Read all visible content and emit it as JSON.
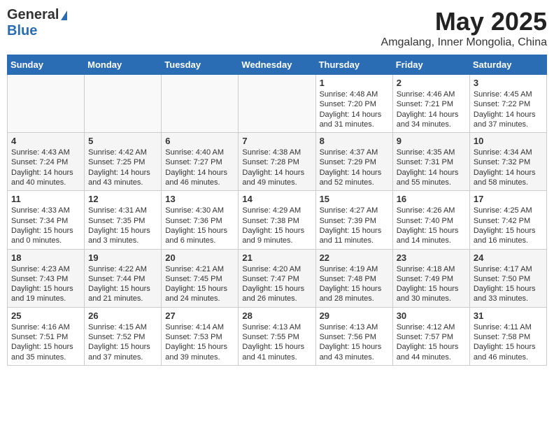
{
  "logo": {
    "general": "General",
    "blue": "Blue"
  },
  "title": "May 2025",
  "location": "Amgalang, Inner Mongolia, China",
  "days_of_week": [
    "Sunday",
    "Monday",
    "Tuesday",
    "Wednesday",
    "Thursday",
    "Friday",
    "Saturday"
  ],
  "weeks": [
    [
      {
        "day": "",
        "content": ""
      },
      {
        "day": "",
        "content": ""
      },
      {
        "day": "",
        "content": ""
      },
      {
        "day": "",
        "content": ""
      },
      {
        "day": "1",
        "content": "Sunrise: 4:48 AM\nSunset: 7:20 PM\nDaylight: 14 hours\nand 31 minutes."
      },
      {
        "day": "2",
        "content": "Sunrise: 4:46 AM\nSunset: 7:21 PM\nDaylight: 14 hours\nand 34 minutes."
      },
      {
        "day": "3",
        "content": "Sunrise: 4:45 AM\nSunset: 7:22 PM\nDaylight: 14 hours\nand 37 minutes."
      }
    ],
    [
      {
        "day": "4",
        "content": "Sunrise: 4:43 AM\nSunset: 7:24 PM\nDaylight: 14 hours\nand 40 minutes."
      },
      {
        "day": "5",
        "content": "Sunrise: 4:42 AM\nSunset: 7:25 PM\nDaylight: 14 hours\nand 43 minutes."
      },
      {
        "day": "6",
        "content": "Sunrise: 4:40 AM\nSunset: 7:27 PM\nDaylight: 14 hours\nand 46 minutes."
      },
      {
        "day": "7",
        "content": "Sunrise: 4:38 AM\nSunset: 7:28 PM\nDaylight: 14 hours\nand 49 minutes."
      },
      {
        "day": "8",
        "content": "Sunrise: 4:37 AM\nSunset: 7:29 PM\nDaylight: 14 hours\nand 52 minutes."
      },
      {
        "day": "9",
        "content": "Sunrise: 4:35 AM\nSunset: 7:31 PM\nDaylight: 14 hours\nand 55 minutes."
      },
      {
        "day": "10",
        "content": "Sunrise: 4:34 AM\nSunset: 7:32 PM\nDaylight: 14 hours\nand 58 minutes."
      }
    ],
    [
      {
        "day": "11",
        "content": "Sunrise: 4:33 AM\nSunset: 7:34 PM\nDaylight: 15 hours\nand 0 minutes."
      },
      {
        "day": "12",
        "content": "Sunrise: 4:31 AM\nSunset: 7:35 PM\nDaylight: 15 hours\nand 3 minutes."
      },
      {
        "day": "13",
        "content": "Sunrise: 4:30 AM\nSunset: 7:36 PM\nDaylight: 15 hours\nand 6 minutes."
      },
      {
        "day": "14",
        "content": "Sunrise: 4:29 AM\nSunset: 7:38 PM\nDaylight: 15 hours\nand 9 minutes."
      },
      {
        "day": "15",
        "content": "Sunrise: 4:27 AM\nSunset: 7:39 PM\nDaylight: 15 hours\nand 11 minutes."
      },
      {
        "day": "16",
        "content": "Sunrise: 4:26 AM\nSunset: 7:40 PM\nDaylight: 15 hours\nand 14 minutes."
      },
      {
        "day": "17",
        "content": "Sunrise: 4:25 AM\nSunset: 7:42 PM\nDaylight: 15 hours\nand 16 minutes."
      }
    ],
    [
      {
        "day": "18",
        "content": "Sunrise: 4:23 AM\nSunset: 7:43 PM\nDaylight: 15 hours\nand 19 minutes."
      },
      {
        "day": "19",
        "content": "Sunrise: 4:22 AM\nSunset: 7:44 PM\nDaylight: 15 hours\nand 21 minutes."
      },
      {
        "day": "20",
        "content": "Sunrise: 4:21 AM\nSunset: 7:45 PM\nDaylight: 15 hours\nand 24 minutes."
      },
      {
        "day": "21",
        "content": "Sunrise: 4:20 AM\nSunset: 7:47 PM\nDaylight: 15 hours\nand 26 minutes."
      },
      {
        "day": "22",
        "content": "Sunrise: 4:19 AM\nSunset: 7:48 PM\nDaylight: 15 hours\nand 28 minutes."
      },
      {
        "day": "23",
        "content": "Sunrise: 4:18 AM\nSunset: 7:49 PM\nDaylight: 15 hours\nand 30 minutes."
      },
      {
        "day": "24",
        "content": "Sunrise: 4:17 AM\nSunset: 7:50 PM\nDaylight: 15 hours\nand 33 minutes."
      }
    ],
    [
      {
        "day": "25",
        "content": "Sunrise: 4:16 AM\nSunset: 7:51 PM\nDaylight: 15 hours\nand 35 minutes."
      },
      {
        "day": "26",
        "content": "Sunrise: 4:15 AM\nSunset: 7:52 PM\nDaylight: 15 hours\nand 37 minutes."
      },
      {
        "day": "27",
        "content": "Sunrise: 4:14 AM\nSunset: 7:53 PM\nDaylight: 15 hours\nand 39 minutes."
      },
      {
        "day": "28",
        "content": "Sunrise: 4:13 AM\nSunset: 7:55 PM\nDaylight: 15 hours\nand 41 minutes."
      },
      {
        "day": "29",
        "content": "Sunrise: 4:13 AM\nSunset: 7:56 PM\nDaylight: 15 hours\nand 43 minutes."
      },
      {
        "day": "30",
        "content": "Sunrise: 4:12 AM\nSunset: 7:57 PM\nDaylight: 15 hours\nand 44 minutes."
      },
      {
        "day": "31",
        "content": "Sunrise: 4:11 AM\nSunset: 7:58 PM\nDaylight: 15 hours\nand 46 minutes."
      }
    ]
  ]
}
